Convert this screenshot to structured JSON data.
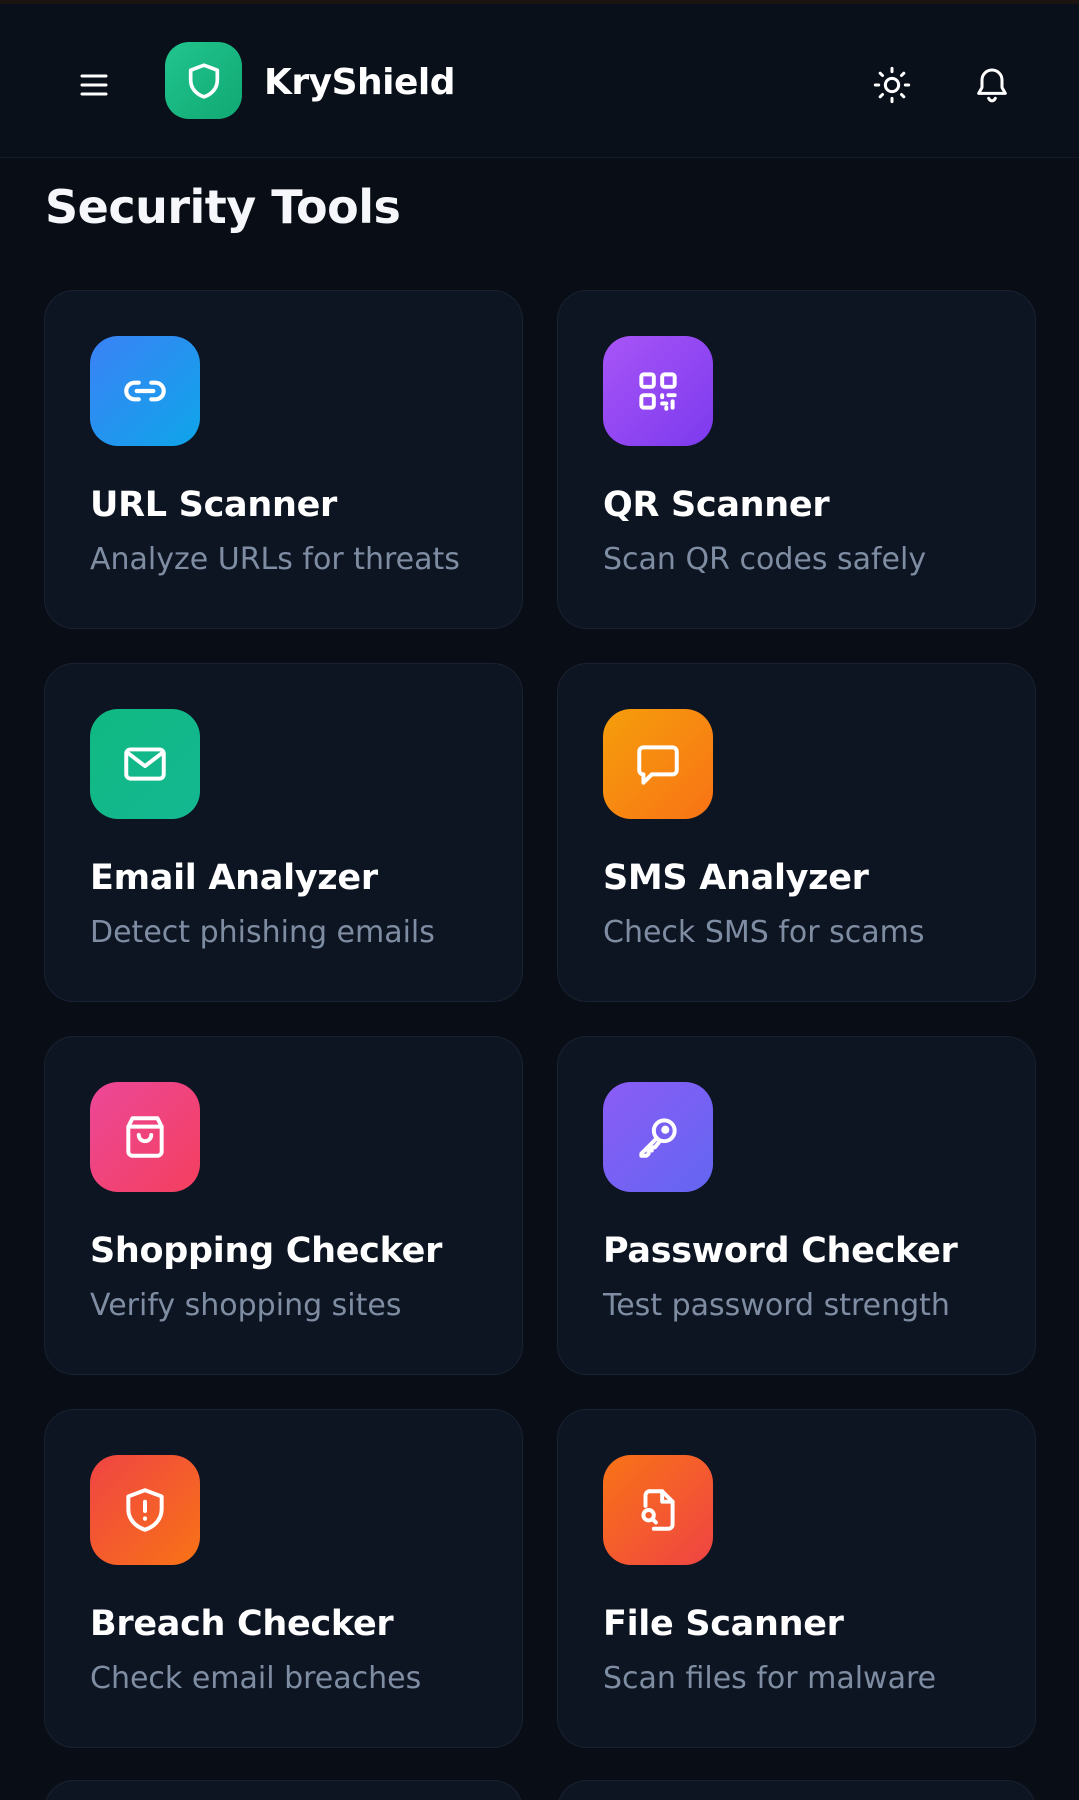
{
  "app": {
    "brand_name": "KryShield",
    "brand_color": "#16b47f"
  },
  "header": {
    "menu_icon": "hamburger-menu-icon",
    "logo_icon": "shield-icon",
    "theme_icon": "sun-icon",
    "notifications_icon": "bell-icon"
  },
  "section": {
    "title": "Security Tools"
  },
  "tools": [
    {
      "title": "URL Scanner",
      "description": "Analyze URLs for threats",
      "icon": "link-icon",
      "color_from": "#3b82f6",
      "color_to": "#0ea5e9"
    },
    {
      "title": "QR Scanner",
      "description": "Scan QR codes safely",
      "icon": "qr-code-icon",
      "color_from": "#a855f7",
      "color_to": "#7c3aed"
    },
    {
      "title": "Email Analyzer",
      "description": "Detect phishing emails",
      "icon": "mail-icon",
      "color_from": "#10b981",
      "color_to": "#14b892"
    },
    {
      "title": "SMS Analyzer",
      "description": "Check SMS for scams",
      "icon": "message-icon",
      "color_from": "#f59e0b",
      "color_to": "#f97316"
    },
    {
      "title": "Shopping Checker",
      "description": "Verify shopping sites",
      "icon": "shopping-bag-icon",
      "color_from": "#ec4899",
      "color_to": "#f43f5e"
    },
    {
      "title": "Password Checker",
      "description": "Test password strength",
      "icon": "key-icon",
      "color_from": "#8b5cf6",
      "color_to": "#6366f1"
    },
    {
      "title": "Breach Checker",
      "description": "Check email breaches",
      "icon": "shield-alert-icon",
      "color_from": "#ef4444",
      "color_to": "#f97316"
    },
    {
      "title": "File Scanner",
      "description": "Scan files for malware",
      "icon": "file-search-icon",
      "color_from": "#f97316",
      "color_to": "#ef4444"
    }
  ]
}
